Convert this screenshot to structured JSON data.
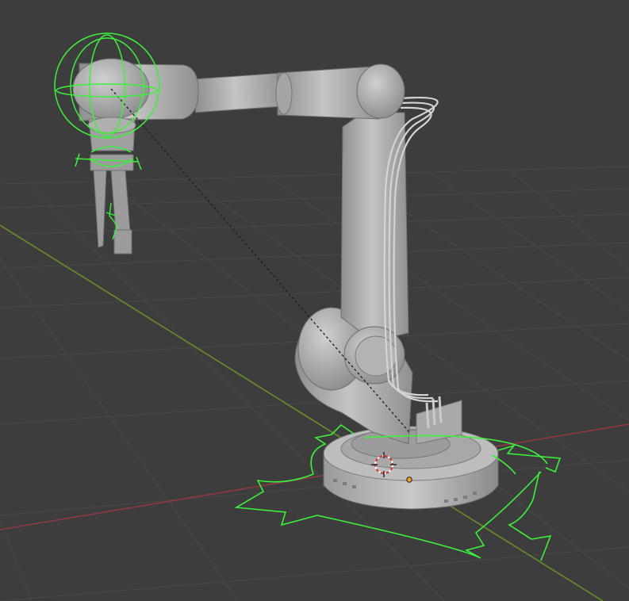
{
  "viewport": {
    "view": "3d-viewport",
    "colors": {
      "background": "#3d3d3d",
      "grid_line": "#474747",
      "x_axis": "#8f3a42",
      "y_axis": "#6a8c2a",
      "rig_control": "#3ef03e",
      "robot_body": "#b7b7b7",
      "origin_dot": "#f2a12c"
    }
  },
  "scene": {
    "object": "robotic-arm",
    "controls": [
      "base-rotation-ring",
      "wrist-gimbal-control",
      "gripper-control"
    ],
    "icons": [
      "3d-cursor-icon",
      "object-origin-icon"
    ]
  }
}
